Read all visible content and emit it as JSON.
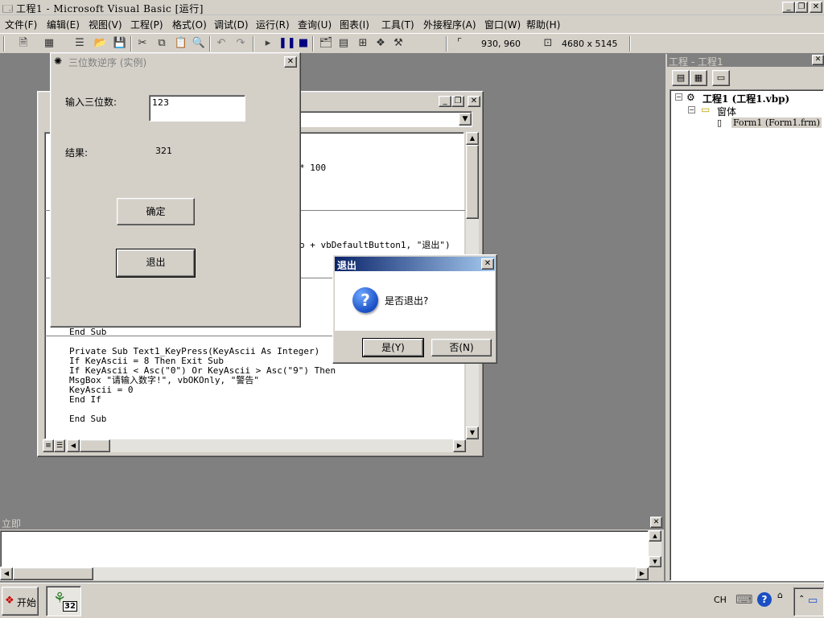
{
  "window": {
    "title": "工程1 - Microsoft Visual Basic [运行]",
    "min": "_",
    "restore": "❐",
    "close": "✕"
  },
  "menu": {
    "items": [
      "文件(F)",
      "编辑(E)",
      "视图(V)",
      "工程(P)",
      "格式(O)",
      "调试(D)",
      "运行(R)",
      "查询(U)",
      "图表(I)",
      "工具(T)",
      "外接程序(A)",
      "窗口(W)",
      "帮助(H)"
    ]
  },
  "toolbar": {
    "position": "930, 960",
    "size": "4680 x 5145",
    "icons": [
      "add-project-icon",
      "add-form-icon",
      "menu-editor-icon",
      "open-icon",
      "save-icon",
      "cut-icon",
      "copy-icon",
      "paste-icon",
      "find-icon",
      "undo-icon",
      "redo-icon",
      "run-icon",
      "pause-icon",
      "stop-icon",
      "project-explorer-icon",
      "properties-icon",
      "form-layout-icon",
      "object-browser-icon",
      "toolbox-icon"
    ]
  },
  "project_panel": {
    "title": "工程 - 工程1",
    "close": "✕",
    "root": "工程1 (工程1.vbp)",
    "folder": "窗体",
    "item": "Form1 (Form1.frm)"
  },
  "code_window": {
    "lines": [
      {
        "text": "* 100",
        "x": 0
      },
      {
        "text": "o + vbDefaultButton1, \"退出\")",
        "x": 0
      },
      {
        "text": "End Sub"
      },
      {
        "text": "Private Sub Text1_KeyPress(KeyAscii As Integer)"
      },
      {
        "text": "If KeyAscii = 8 Then Exit Sub"
      },
      {
        "text": "If KeyAscii < Asc(\"0\") Or KeyAscii > Asc(\"9\") Then"
      },
      {
        "text": "MsgBox \"请输入数字!\", vbOKOnly, \"警告\""
      },
      {
        "text": "KeyAscii = 0"
      },
      {
        "text": "End If"
      },
      {
        "text": "End Sub"
      }
    ]
  },
  "form": {
    "title": "三位数逆序 (实例)",
    "close": "✕",
    "input_label": "输入三位数:",
    "input_value": "123",
    "result_label": "结果:",
    "result_value": "321",
    "ok_button": "确定",
    "exit_button": "退出"
  },
  "msgbox": {
    "title": "退出",
    "close": "✕",
    "message": "是否退出?",
    "yes": "是(Y)",
    "no": "否(N)",
    "icon": "?"
  },
  "immediate": {
    "title": "立即",
    "close": "✕"
  },
  "taskbar": {
    "start": "开始",
    "lang": "CH",
    "task_label": "32"
  }
}
